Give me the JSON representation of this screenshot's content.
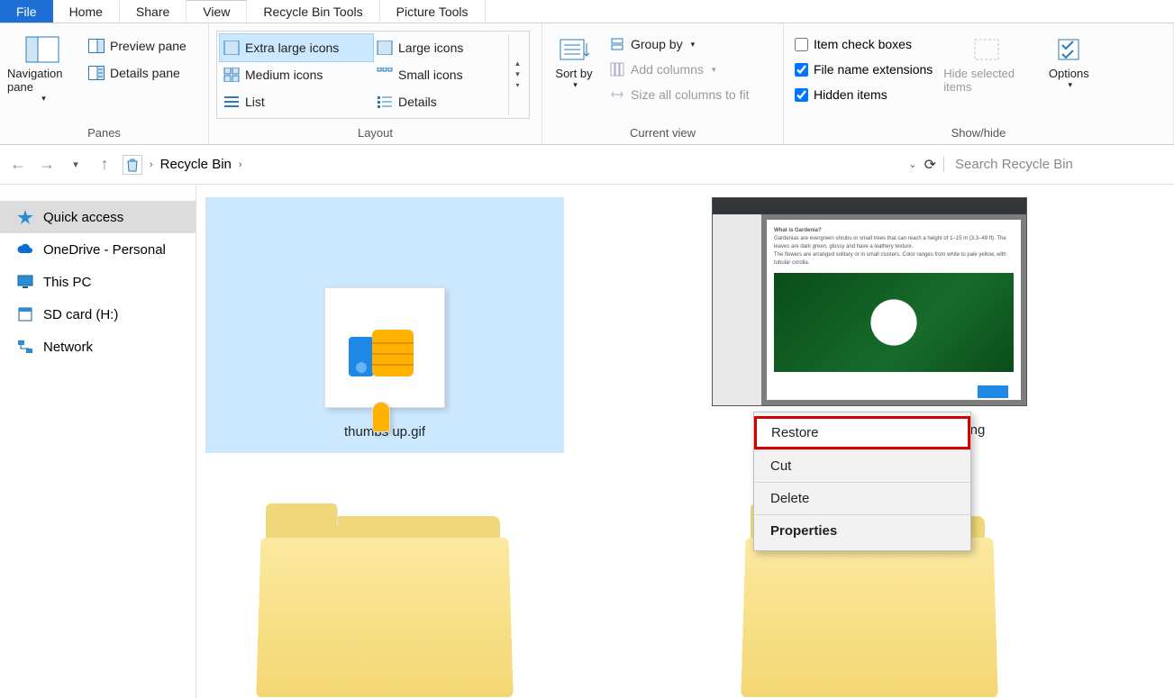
{
  "tabs": {
    "file": "File",
    "home": "Home",
    "share": "Share",
    "view": "View",
    "tool1": "Recycle Bin Tools",
    "tool2": "Picture Tools"
  },
  "ribbon": {
    "panes": {
      "label": "Panes",
      "nav": "Navigation pane",
      "preview": "Preview pane",
      "details": "Details pane"
    },
    "layout": {
      "label": "Layout",
      "xl": "Extra large icons",
      "lg": "Large icons",
      "md": "Medium icons",
      "sm": "Small icons",
      "list": "List",
      "det": "Details"
    },
    "current": {
      "label": "Current view",
      "sort": "Sort by",
      "group": "Group by",
      "addcols": "Add columns",
      "sizecols": "Size all columns to fit"
    },
    "showhide": {
      "label": "Show/hide",
      "itemcb": "Item check boxes",
      "ext": "File name extensions",
      "hidden": "Hidden items",
      "hidesel": "Hide selected items",
      "options": "Options"
    }
  },
  "nav": {
    "location": "Recycle Bin",
    "search_placeholder": "Search Recycle Bin"
  },
  "sidebar": {
    "items": [
      {
        "label": "Quick access"
      },
      {
        "label": "OneDrive - Personal"
      },
      {
        "label": "This PC"
      },
      {
        "label": "SD card (H:)"
      },
      {
        "label": "Network"
      }
    ]
  },
  "files": {
    "f1": "thumbs up.gif",
    "f2": "r-data-from-raspberry-pi-sd-card-3.png"
  },
  "context": {
    "restore": "Restore",
    "cut": "Cut",
    "delete": "Delete",
    "properties": "Properties"
  },
  "checks": {
    "itemcb": false,
    "ext": true,
    "hidden": true
  }
}
